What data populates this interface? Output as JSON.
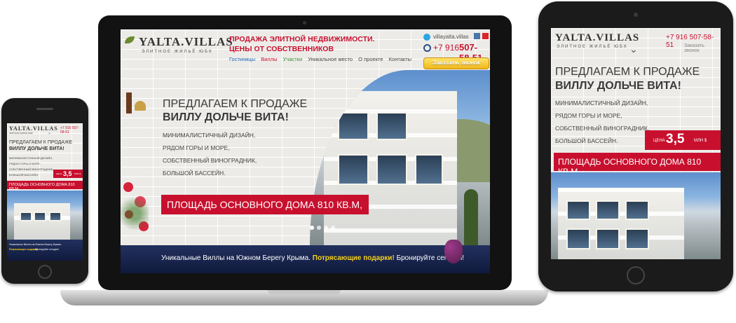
{
  "brand": {
    "logo": "YALTA.VILLAS",
    "tagline": "ЭЛИТНОЕ ЖИЛЬЁ ЮБК"
  },
  "header": {
    "headline_1": "ПРОДАЖА ЭЛИТНОЙ НЕДВИЖИМОСТИ.",
    "headline_2": "ЦЕНЫ ОТ СОБСТВЕННИКОВ",
    "skype": "villayalta.villas",
    "phone_prefix": "+7 916",
    "phone_number": "507-58-51",
    "phone_full_small": "+7 916 507-58-51",
    "callback": "Заказать звонок"
  },
  "nav": [
    "Гостиницы",
    "Виллы",
    "Участки",
    "Уникальное место",
    "О проекте",
    "Контакты"
  ],
  "hero": {
    "line_1": "ПРЕДЛАГАЕМ К ПРОДАЖЕ",
    "line_2": "ВИЛЛУ ДОЛЬЧЕ ВИТА!",
    "features": [
      "МИНИМАЛИСТИЧНЫЙ ДИЗАЙН,",
      "РЯДОМ ГОРЫ И МОРЕ,",
      "СОБСТВЕННЫЙ ВИНОГРАДНИК,",
      "БОЛЬШОЙ БАССЕЙН."
    ],
    "area": "ПЛОЩАДЬ ОСНОВНОГО ДОМА 810 КВ.М,",
    "price_label": "ЦЕНА",
    "price_value": "3,5",
    "price_unit": "МЛН $"
  },
  "bottom": {
    "text_1": "Уникальные Виллы на Южном Берегу Крыма.",
    "text_2": "Потрясающие подарки!",
    "text_3": "Бронируйте сегодня!",
    "phone_text_1": "Уникальные Виллы на Южном Берегу Крыма.",
    "phone_text_2": "Потрясающие подарки!",
    "phone_text_3": "Бронируйте сегодня!"
  },
  "colors": {
    "accent": "#c8102e",
    "bar": "#1a2550",
    "highlight": "#f6d21e"
  }
}
